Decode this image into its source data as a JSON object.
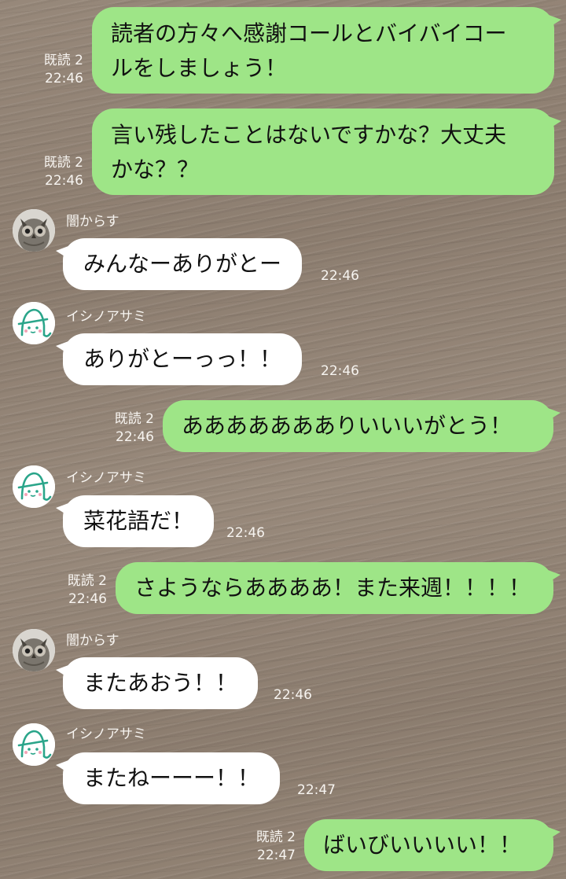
{
  "users": {
    "yami": {
      "name": "闇からす",
      "avatar_icon": "owl-icon"
    },
    "ishino": {
      "name": "イシノアサミ",
      "avatar_icon": "ghost-letter-a-icon",
      "accent": "#2aa58a"
    }
  },
  "colors": {
    "outgoing_bubble": "#9ee587",
    "incoming_bubble": "#ffffff"
  },
  "messages": [
    {
      "dir": "out",
      "lines": [
        "読者の方々へ感謝コールとバイバイコー",
        "ルをしましょう！"
      ],
      "read": "既読 2",
      "time": "22:46"
    },
    {
      "dir": "out",
      "lines": [
        "言い残したことはないですかな？大丈夫",
        "かな？？"
      ],
      "read": "既読 2",
      "time": "22:46"
    },
    {
      "dir": "in",
      "sender": "闇からす",
      "text": "みんなーありがとー",
      "time": "22:46"
    },
    {
      "dir": "in",
      "sender": "イシノアサミ",
      "text": "ありがとーっっ！！",
      "time": "22:46"
    },
    {
      "dir": "out",
      "text": "ああああああありいいいがとう！",
      "read": "既読 2",
      "time": "22:46"
    },
    {
      "dir": "in",
      "sender": "イシノアサミ",
      "text": "菜花語だ！",
      "time": "22:46"
    },
    {
      "dir": "out",
      "text": "さようならああああ！また来週！！！！",
      "read": "既読 2",
      "time": "22:46"
    },
    {
      "dir": "in",
      "sender": "闇からす",
      "text": "またあおう！！",
      "time": "22:46"
    },
    {
      "dir": "in",
      "sender": "イシノアサミ",
      "text": "またねーーー！！",
      "time": "22:47"
    },
    {
      "dir": "out",
      "text": "ばいびいいいい！！",
      "read": "既読 2",
      "time": "22:47"
    }
  ]
}
